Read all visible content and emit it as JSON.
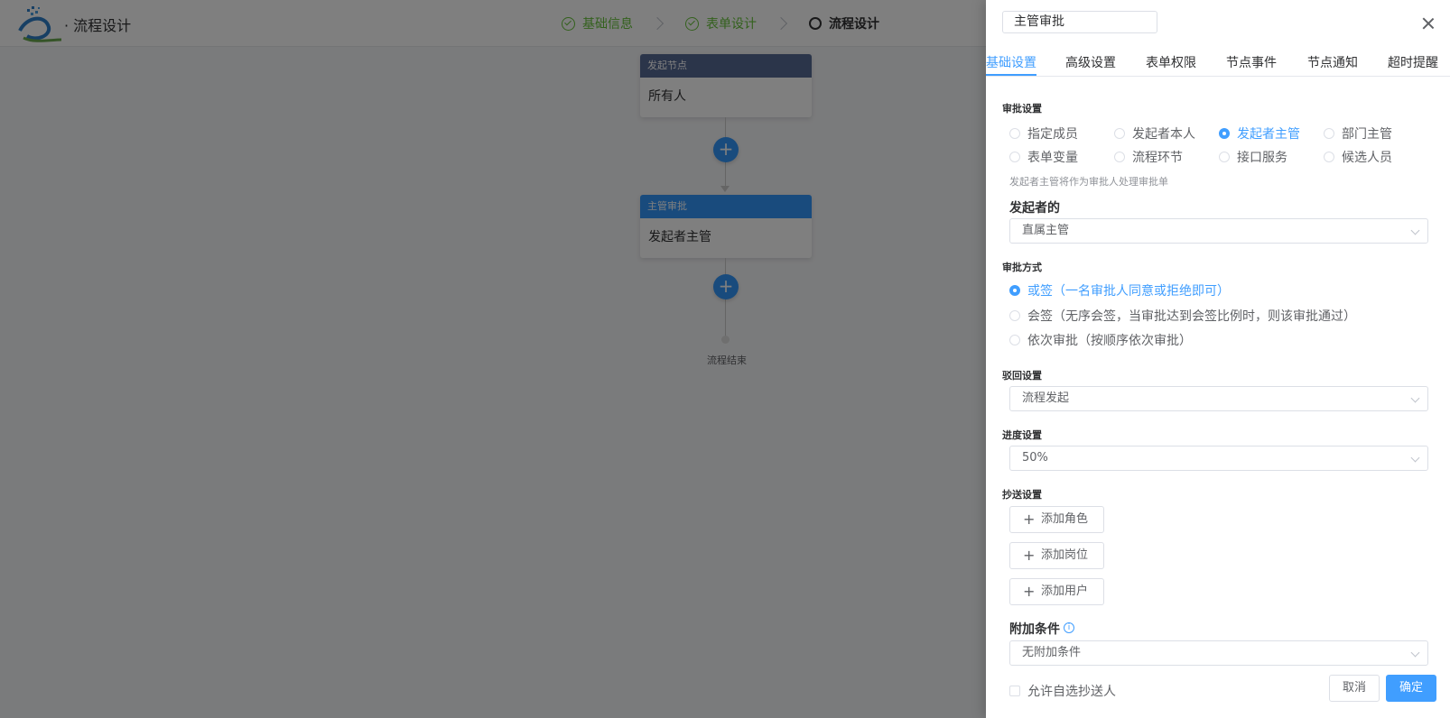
{
  "app": {
    "title": "· 流程设计",
    "steps": [
      {
        "label": "基础信息",
        "status": "done"
      },
      {
        "label": "表单设计",
        "status": "done"
      },
      {
        "label": "流程设计",
        "status": "active"
      }
    ]
  },
  "flow": {
    "start_node": {
      "header": "发起节点",
      "body": "所有人"
    },
    "approve_node": {
      "header": "主管审批",
      "body": "发起者主管"
    },
    "add_symbol": "+",
    "end_label": "流程结束"
  },
  "drawer": {
    "title_value": "主管审批",
    "tabs": [
      "基础设置",
      "高级设置",
      "表单权限",
      "节点事件",
      "节点通知",
      "超时提醒"
    ],
    "active_tab": "基础设置",
    "approval_setting": {
      "label": "审批设置",
      "options": [
        "指定成员",
        "发起者本人",
        "发起者主管",
        "部门主管",
        "表单变量",
        "流程环节",
        "接口服务",
        "候选人员"
      ],
      "selected": "发起者主管",
      "hint": "发起者主管将作为审批人处理审批单",
      "initiator_label": "发起者的",
      "initiator_value": "直属主管"
    },
    "approval_method": {
      "label": "审批方式",
      "options": [
        "或签（一名审批人同意或拒绝即可）",
        "会签（无序会签，当审批达到会签比例时，则该审批通过）",
        "依次审批（按顺序依次审批）"
      ],
      "selected": "或签（一名审批人同意或拒绝即可）"
    },
    "reject_setting": {
      "label": "驳回设置",
      "value": "流程发起"
    },
    "progress_setting": {
      "label": "进度设置",
      "value": "50%"
    },
    "cc_setting": {
      "label": "抄送设置",
      "buttons": [
        "添加角色",
        "添加岗位",
        "添加用户"
      ],
      "plus": "+"
    },
    "extra_condition": {
      "label": "附加条件",
      "info_symbol": "i",
      "value": "无附加条件"
    },
    "allow_self_cc": "允许自选抄送人",
    "cancel_label": "取消",
    "confirm_label": "确定"
  },
  "colors": {
    "accent": "#409eff",
    "node_start": "#576a95",
    "node_approve": "#3296fa",
    "success": "#67c23a"
  }
}
